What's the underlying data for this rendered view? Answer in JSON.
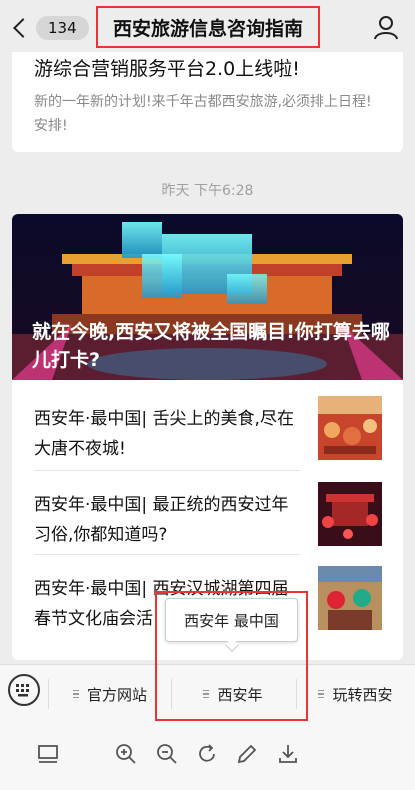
{
  "header": {
    "back_count": "134",
    "title": "西安旅游信息咨询指南"
  },
  "top_card": {
    "headline": "游综合营销服务平台2.0上线啦!",
    "description": "新的一年新的计划!来千年古都西安旅游,必须排上日程!安排!"
  },
  "timestamp": "昨天 下午6:28",
  "main_card": {
    "hero_title": "就在今晚,西安又将被全国瞩目!你打算去哪儿打卡?",
    "items": [
      {
        "title": "西安年·最中国| 舌尖上的美食,尽在大唐不夜城!"
      },
      {
        "title": "西安年·最中国| 最正统的西安过年习俗,你都知道吗?"
      },
      {
        "title": "西安年·最中国| 西安汉城湖第四届春节文化庙会活"
      }
    ]
  },
  "popup": {
    "label": "西安年 最中国"
  },
  "menu": {
    "items": [
      {
        "label": "官方网站"
      },
      {
        "label": "西安年"
      },
      {
        "label": "玩转西安"
      }
    ]
  },
  "colors": {
    "highlight": "#e33333",
    "background": "#ededed"
  }
}
